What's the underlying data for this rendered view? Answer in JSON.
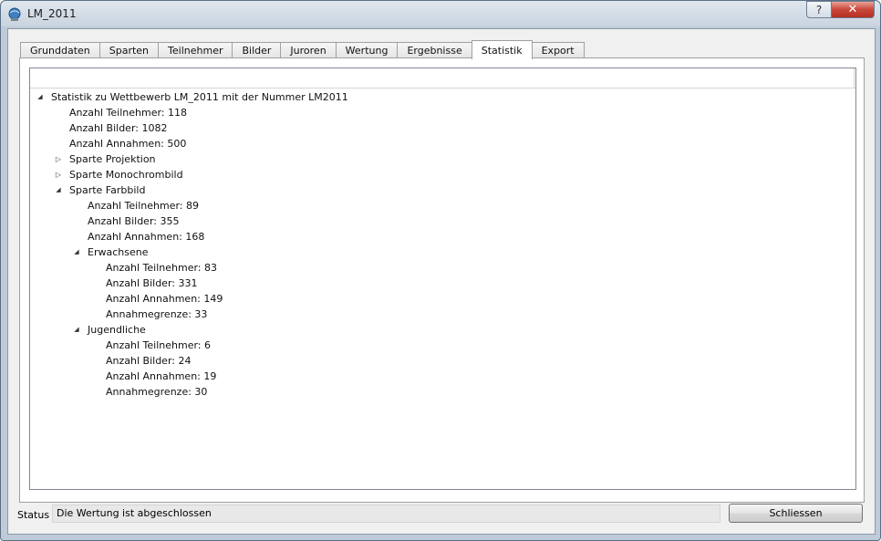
{
  "window": {
    "title": "LM_2011",
    "help_label": "?",
    "close_label": "✕"
  },
  "tabs": [
    {
      "label": "Grunddaten"
    },
    {
      "label": "Sparten"
    },
    {
      "label": "Teilnehmer"
    },
    {
      "label": "Bilder"
    },
    {
      "label": "Juroren"
    },
    {
      "label": "Wertung"
    },
    {
      "label": "Ergebnisse"
    },
    {
      "label": "Statistik",
      "active": true
    },
    {
      "label": "Export"
    }
  ],
  "tree": [
    {
      "level": 0,
      "expander": "expanded",
      "text": "Statistik zu Wettbewerb LM_2011 mit der Nummer LM2011"
    },
    {
      "level": 1,
      "expander": "none",
      "text": "Anzahl Teilnehmer: 118"
    },
    {
      "level": 1,
      "expander": "none",
      "text": "Anzahl Bilder: 1082"
    },
    {
      "level": 1,
      "expander": "none",
      "text": "Anzahl Annahmen: 500"
    },
    {
      "level": 1,
      "expander": "collapsed",
      "text": "Sparte Projektion"
    },
    {
      "level": 1,
      "expander": "collapsed",
      "text": "Sparte Monochrombild"
    },
    {
      "level": 1,
      "expander": "expanded",
      "text": "Sparte Farbbild"
    },
    {
      "level": 2,
      "expander": "none",
      "text": "Anzahl Teilnehmer: 89"
    },
    {
      "level": 2,
      "expander": "none",
      "text": "Anzahl Bilder: 355"
    },
    {
      "level": 2,
      "expander": "none",
      "text": "Anzahl Annahmen: 168"
    },
    {
      "level": 2,
      "expander": "expanded",
      "text": "Erwachsene"
    },
    {
      "level": 3,
      "expander": "none",
      "text": "Anzahl Teilnehmer: 83"
    },
    {
      "level": 3,
      "expander": "none",
      "text": "Anzahl Bilder: 331"
    },
    {
      "level": 3,
      "expander": "none",
      "text": "Anzahl Annahmen: 149"
    },
    {
      "level": 3,
      "expander": "none",
      "text": "Annahmegrenze: 33"
    },
    {
      "level": 2,
      "expander": "expanded",
      "text": "Jugendliche"
    },
    {
      "level": 3,
      "expander": "none",
      "text": "Anzahl Teilnehmer: 6"
    },
    {
      "level": 3,
      "expander": "none",
      "text": "Anzahl Bilder: 24"
    },
    {
      "level": 3,
      "expander": "none",
      "text": "Anzahl Annahmen: 19"
    },
    {
      "level": 3,
      "expander": "none",
      "text": "Annahmegrenze: 30"
    }
  ],
  "status": {
    "label": "Status",
    "text": "Die Wertung ist abgeschlossen"
  },
  "buttons": {
    "close_label": "Schliessen"
  },
  "icons": {
    "expanded": "triangle-expanded-icon",
    "collapsed": "triangle-collapsed-icon",
    "app": "globe-icon"
  }
}
